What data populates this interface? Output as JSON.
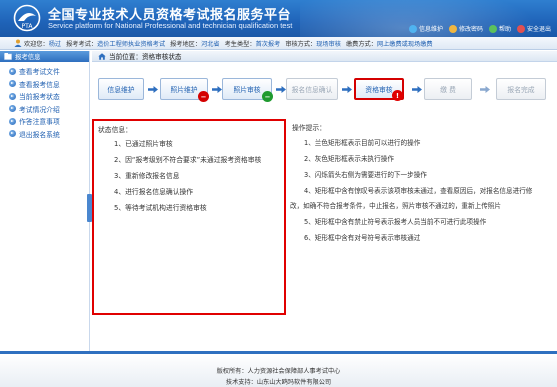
{
  "header": {
    "title": "全国专业技术人员资格考试报名服务平台",
    "subtitle": "Service platform for National Professional and technician qualification test",
    "links": {
      "info_maintain": "信息维护",
      "change_password": "修改密码",
      "help": "帮助",
      "safe_exit": "安全退出"
    }
  },
  "infobar": {
    "welcome_label": "欢迎您：",
    "welcome_value": "杨过",
    "exam_label": "报考考试：",
    "exam_value": "造价工程师执业资格考试",
    "region_label": "报考地区：",
    "region_value": "河北省",
    "candidate_label": "考生类型：",
    "candidate_value": "首次报考",
    "review_label": "审核方式：",
    "review_value": "现场审核",
    "payment_label": "缴费方式：",
    "payment_value": "网上缴费或现场缴费"
  },
  "sidebar": {
    "header": "报考信息",
    "items": [
      {
        "label": "查看考试文件"
      },
      {
        "label": "查看报考信息"
      },
      {
        "label": "当前报考状态"
      },
      {
        "label": "考试情况介绍"
      },
      {
        "label": "作答注意事项"
      },
      {
        "label": "退出报名系统"
      }
    ]
  },
  "breadcrumb": {
    "label": "当前位置：资格审核状态"
  },
  "steps": [
    {
      "label": "信息维护",
      "state": "active"
    },
    {
      "label": "照片维护",
      "state": "active",
      "badge": "−",
      "badge_color": "#d40000"
    },
    {
      "label": "照片审核",
      "state": "active",
      "badge": "−",
      "badge_color": "#1f9a2f"
    },
    {
      "label": "报名信息确认",
      "state": "disabled"
    },
    {
      "label": "资格审核",
      "state": "current",
      "badge": "!",
      "badge_color": "#e00000"
    },
    {
      "label": "缴 费",
      "state": "disabled"
    },
    {
      "label": "报名完成",
      "state": "disabled"
    }
  ],
  "status": {
    "title": "状态信息：",
    "lines": [
      "1、已通过照片审核",
      "2、因“报考级别不符合要求”未通过报考资格审核",
      "3、重新修改报名信息",
      "4、进行报名信息确认操作",
      "5、等待考试机构进行资格审核"
    ]
  },
  "tips": {
    "title": "操作提示：",
    "lines": [
      "1、兰色矩形框表示目前可以进行的操作",
      "2、灰色矩形框表示未执行操作",
      "3、闪烁箭头右侧为需要进行的下一步操作",
      "4、矩形框中含有惊叹号表示该项审核未通过，查看原因后，对报名信息进行修",
      "改，如确不符合报考条件，中止报名，照片审核不通过的，重新上传照片",
      "5、矩形框中含有禁止符号表示报考人员当前不可进行此项操作",
      "6、矩形框中含有对号符号表示审核通过"
    ]
  },
  "footer": {
    "owner": "版权所有：人力资源社会保障部人事考试中心",
    "support": "技术支持：山东山大鸥玛软件有限公司"
  },
  "colors": {
    "brand_blue": "#1f63b8",
    "link_blue": "#1f5fb0",
    "alert_red": "#e00000",
    "ok_green": "#1f9a2f"
  }
}
